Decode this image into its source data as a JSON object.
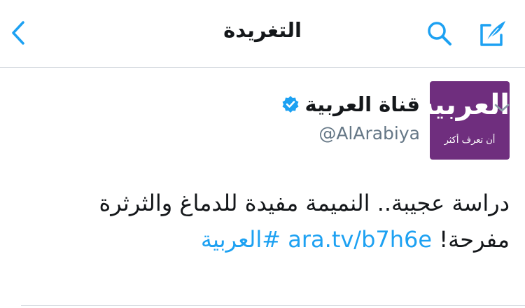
{
  "navbar": {
    "title": "التغريدة",
    "back_icon": "chevron-left-icon",
    "search_icon": "search-icon",
    "compose_icon": "compose-tweet-icon"
  },
  "colors": {
    "accent": "#1da1f2",
    "text": "#14171a",
    "muted": "#657786",
    "avatar_bg": "#6f2e7e"
  },
  "tweet": {
    "author": {
      "display_name": "قناة العربية",
      "handle": "@AlArabiya",
      "verified": true,
      "avatar_logo": "العربية",
      "avatar_tagline": "أن تعرف أكثر"
    },
    "text_line1": "دراسة عجيبة.. النميمة مفيدة للدماغ والثرثرة",
    "text_line2_prefix": "مفرحة! ",
    "link": "ara.tv/b7h6e",
    "hashtag": "#العربية"
  }
}
